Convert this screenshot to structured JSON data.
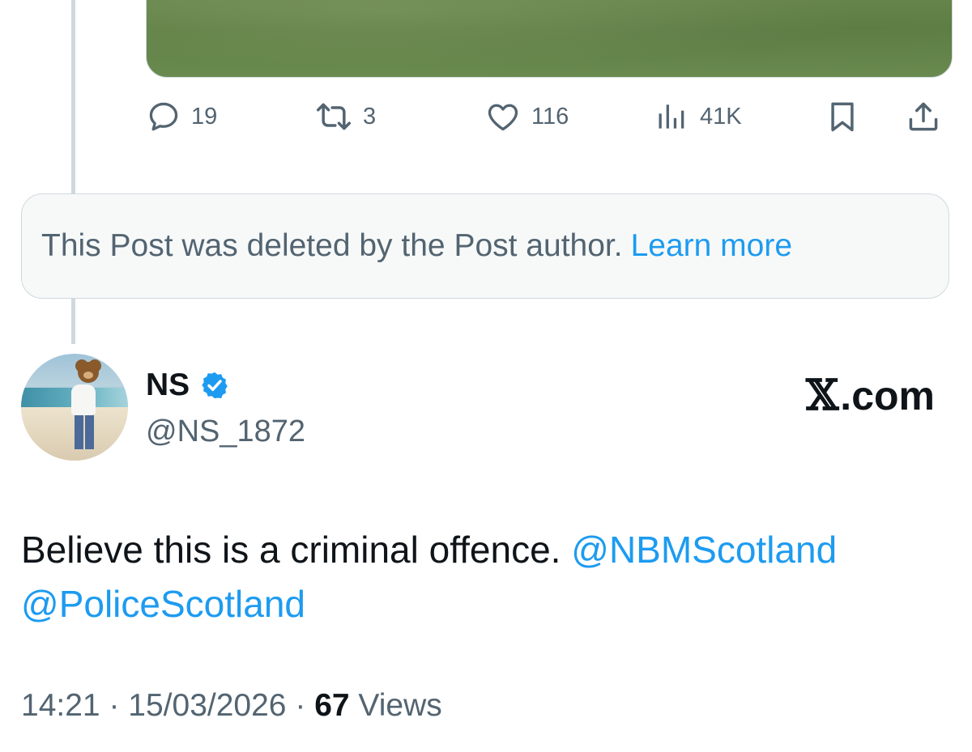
{
  "previous_post": {
    "media": {
      "description_icon": "photo"
    },
    "actions": {
      "reply": {
        "icon": "reply-icon",
        "count": "19"
      },
      "repost": {
        "icon": "repost-icon",
        "count": "3"
      },
      "like": {
        "icon": "like-icon",
        "count": "116"
      },
      "views": {
        "icon": "views-icon",
        "count": "41K"
      },
      "bookmark": {
        "icon": "bookmark-icon"
      },
      "share": {
        "icon": "share-icon"
      }
    }
  },
  "deleted_notice": {
    "text": "This Post was deleted by the Post author.",
    "link": "Learn more"
  },
  "post": {
    "author": {
      "display_name": "NS",
      "handle": "@NS_1872",
      "verified": true
    },
    "brand": {
      "x": "𝕏",
      "suffix": ".com"
    },
    "text": "Believe this is a criminal offence.",
    "mentions": [
      "@NBMScotland",
      "@PoliceScotland"
    ],
    "time": "14:21",
    "date": "15/03/2026",
    "separator": "·",
    "views_count": "67",
    "views_label": "Views"
  },
  "colors": {
    "accent": "#1d9bf0",
    "secondary_text": "#536471",
    "primary_text": "#0f1419",
    "border": "#cfd9de"
  }
}
